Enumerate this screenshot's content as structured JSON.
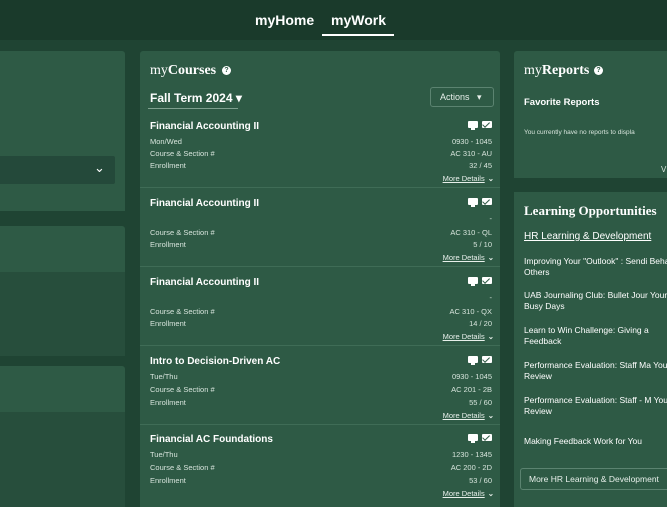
{
  "nav": {
    "tabs": [
      "myHome",
      "myWork"
    ],
    "active": "myWork"
  },
  "courses_panel": {
    "title_prefix": "my",
    "title_main": "Courses",
    "help": "?",
    "term": "Fall Term 2024",
    "term_caret": "▾",
    "actions_label": "Actions",
    "actions_caret": "▾",
    "more_label": "More Details",
    "more_chevron": "⌄",
    "courses": [
      {
        "name": "Financial Accounting II",
        "days": "Mon/Wed",
        "time": "0930 - 1045",
        "section_label": "Course & Section #",
        "section": "AC 310 - AU",
        "enroll_label": "Enrollment",
        "enroll": "32 / 45"
      },
      {
        "name": "Financial Accounting II",
        "days": "",
        "time": "-",
        "section_label": "Course & Section #",
        "section": "AC 310 - QL",
        "enroll_label": "Enrollment",
        "enroll": "5 / 10"
      },
      {
        "name": "Financial Accounting II",
        "days": "",
        "time": "-",
        "section_label": "Course & Section #",
        "section": "AC 310 - QX",
        "enroll_label": "Enrollment",
        "enroll": "14 / 20"
      },
      {
        "name": "Intro to Decision-Driven AC",
        "days": "Tue/Thu",
        "time": "0930 - 1045",
        "section_label": "Course & Section #",
        "section": "AC 201 - 2B",
        "enroll_label": "Enrollment",
        "enroll": "55 / 60"
      },
      {
        "name": "Financial AC Foundations",
        "days": "Tue/Thu",
        "time": "1230 - 1345",
        "section_label": "Course & Section #",
        "section": "AC 200 - 2D",
        "enroll_label": "Enrollment",
        "enroll": "53 / 60"
      }
    ]
  },
  "reports_panel": {
    "title_prefix": "my",
    "title_main": "Reports",
    "help": "?",
    "favorites": "Favorite Reports",
    "empty": "You currently have no reports to displa",
    "view_truncated": "V"
  },
  "learning_panel": {
    "title": "Learning Opportunities",
    "hr_link": "HR Learning & Development",
    "items": [
      "Improving Your \"Outlook\" : Sendi Behalf of Others",
      "UAB Journaling Club: Bullet Jour Your Busy Days",
      "Learn to Win Challenge: Giving a Feedback",
      "Performance Evaluation: Staff Ma Your Review",
      "Performance Evaluation: Staff - M Your Review",
      "Making Feedback Work for You"
    ],
    "more_button": "More HR Learning & Development"
  },
  "left_panel": {
    "select_chevron": "⌄"
  },
  "colors": {
    "background": "#1f4433",
    "panel": "#2e5a45",
    "nav": "#1a3a2b",
    "divider": "#3f6c56"
  }
}
